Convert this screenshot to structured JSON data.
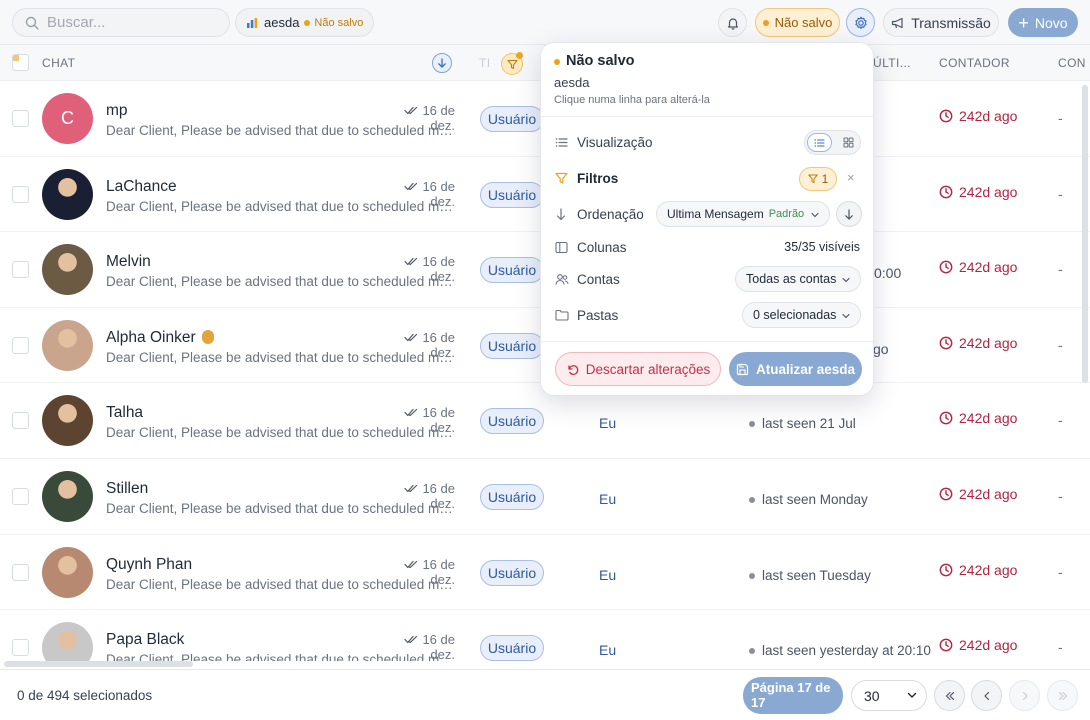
{
  "topbar": {
    "search_placeholder": "Buscar...",
    "view_name": "aesda",
    "view_status": "Não salvo",
    "unsaved_label": "Não salvo",
    "broadcast_label": "Transmissão",
    "new_label": "Novo"
  },
  "table": {
    "headers": {
      "chat": "CHAT",
      "type_partial": "TI",
      "last_partial": "ÚLTI...",
      "counter": "CONTADOR",
      "contact_partial": "CON"
    },
    "rows": [
      {
        "name": "mp",
        "avatar_letter": "C",
        "avatar_color": "#e0607a",
        "date": "16 de dez.",
        "message": "Dear Client, Please be advised that due to scheduled maintenance",
        "badge": "Usuário",
        "owner": "",
        "last_seen": "",
        "counter": "242d ago",
        "contact": "-"
      },
      {
        "name": "LaChance",
        "avatar_letter": "",
        "avatar_color": "#1a1f33",
        "date": "16 de dez.",
        "message": "Dear Client, Please be advised that due to scheduled maintenance",
        "badge": "Usuário",
        "owner": "",
        "last_seen": "",
        "counter": "242d ago",
        "contact": "-"
      },
      {
        "name": "Melvin",
        "avatar_letter": "",
        "avatar_color": "#6b5a44",
        "date": "16 de dez.",
        "message": "Dear Client, Please be advised that due to scheduled maintenance",
        "badge": "Usuário",
        "owner": "",
        "last_seen": "0:00",
        "counter": "242d ago",
        "contact": "-"
      },
      {
        "name": "Alpha Oinker",
        "avatar_letter": "",
        "avatar_color": "#c9a58e",
        "date": "16 de dez.",
        "message": "Dear Client, Please be advised that due to scheduled maintenance",
        "badge": "Usuário",
        "owner": "",
        "last_seen": "go",
        "counter": "242d ago",
        "contact": "-"
      },
      {
        "name": "Talha",
        "avatar_letter": "",
        "avatar_color": "#5c4430",
        "date": "16 de dez.",
        "message": "Dear Client, Please be advised that due to scheduled maintenance",
        "badge": "Usuário",
        "owner": "Eu",
        "last_seen": "last seen 21 Jul",
        "counter": "242d ago",
        "contact": "-"
      },
      {
        "name": "Stillen",
        "avatar_letter": "",
        "avatar_color": "#3a4a3a",
        "date": "16 de dez.",
        "message": "Dear Client, Please be advised that due to scheduled maintenance",
        "badge": "Usuário",
        "owner": "Eu",
        "last_seen": "last seen Monday",
        "counter": "242d ago",
        "contact": "-"
      },
      {
        "name": "Quynh Phan",
        "avatar_letter": "",
        "avatar_color": "#b78970",
        "date": "16 de dez.",
        "message": "Dear Client, Please be advised that due to scheduled maintenance",
        "badge": "Usuário",
        "owner": "Eu",
        "last_seen": "last seen Tuesday",
        "counter": "242d ago",
        "contact": "-"
      },
      {
        "name": "Papa Black",
        "avatar_letter": "",
        "avatar_color": "#c8c8c8",
        "date": "16 de dez.",
        "message": "Dear Client, Please be advised that due to scheduled maintenance",
        "badge": "Usuário",
        "owner": "Eu",
        "last_seen": "last seen yesterday at 20:10",
        "counter": "242d ago",
        "contact": "-"
      }
    ]
  },
  "popover": {
    "title": "Não salvo",
    "view_name": "aesda",
    "hint": "Clique numa linha para alterá-la",
    "visualization_label": "Visualização",
    "filters_label": "Filtros",
    "filters_count": "1",
    "filters_clear": "×",
    "ordering_label": "Ordenação",
    "ordering_value": "Ultima Mensagem",
    "ordering_default": "Padrão",
    "columns_label": "Colunas",
    "columns_value": "35/35 visíveis",
    "accounts_label": "Contas",
    "accounts_value": "Todas as contas",
    "folders_label": "Pastas",
    "folders_value": "0 selecionadas",
    "discard_label": "Descartar alterações",
    "update_label": "Atualizar aesda"
  },
  "footer": {
    "selected_text": "0 de 494 selecionados",
    "page_text": "Página 17 de 17",
    "per_page": "30"
  },
  "colors": {
    "accent": "#8aa9d2",
    "warning": "#e8a317",
    "danger": "#b4233f"
  }
}
